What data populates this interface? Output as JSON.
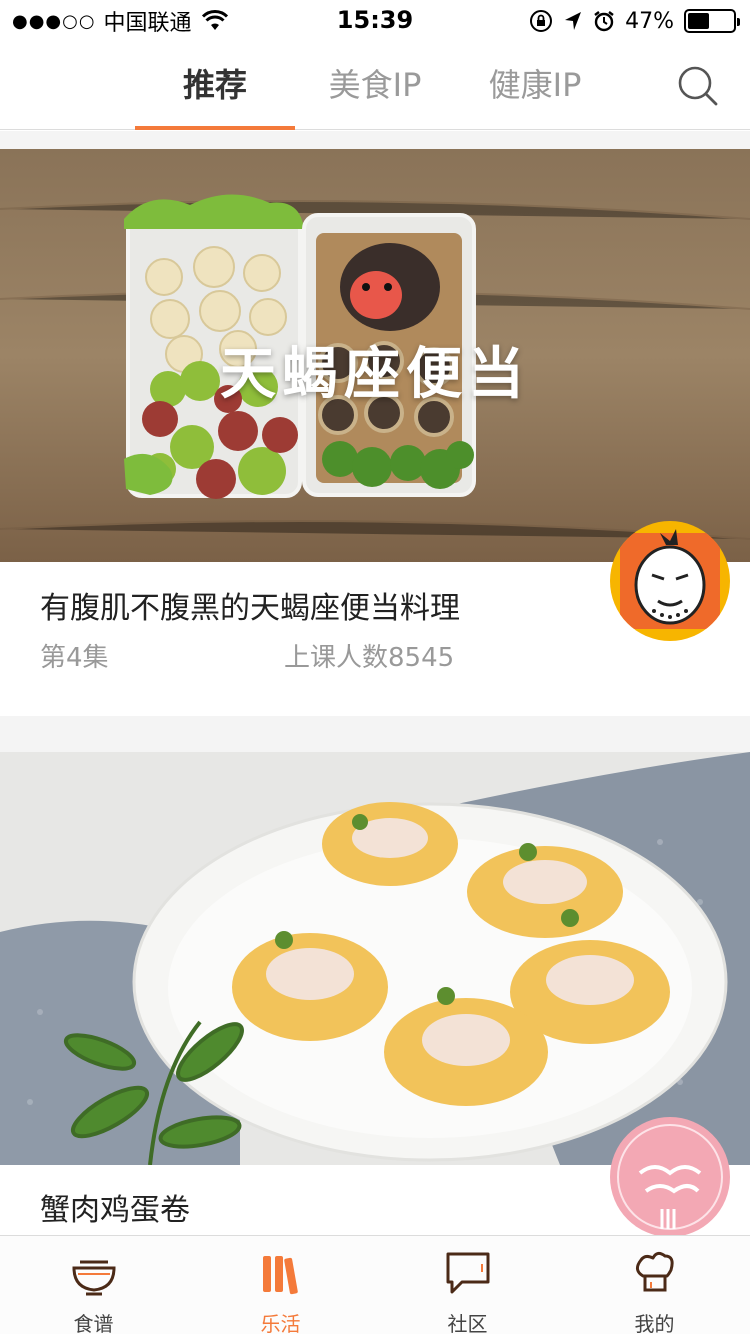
{
  "status_bar": {
    "signal": "●●●○○",
    "carrier": "中国联通",
    "time": "15:39",
    "battery": "47%"
  },
  "tabs": [
    {
      "label": "推荐",
      "active": true
    },
    {
      "label": "美食IP",
      "active": false
    },
    {
      "label": "健康IP",
      "active": false
    }
  ],
  "search_icon": "search-icon",
  "feed": {
    "cards": [
      {
        "image_text": "天蝎座便当",
        "title": "有腹肌不腹黑的天蝎座便当料理",
        "episode": "第4集",
        "attendance": "上课人数8545"
      },
      {
        "title": "蟹肉鸡蛋卷"
      }
    ]
  },
  "bottom_nav": [
    {
      "label": "食谱",
      "icon": "bowl-icon",
      "active": false
    },
    {
      "label": "乐活",
      "icon": "books-icon",
      "active": true
    },
    {
      "label": "社区",
      "icon": "chat-icon",
      "active": false
    },
    {
      "label": "我的",
      "icon": "chef-hat-icon",
      "active": false
    }
  ],
  "colors": {
    "accent": "#f47a3a",
    "inactive_tab": "#9a9a9a"
  }
}
